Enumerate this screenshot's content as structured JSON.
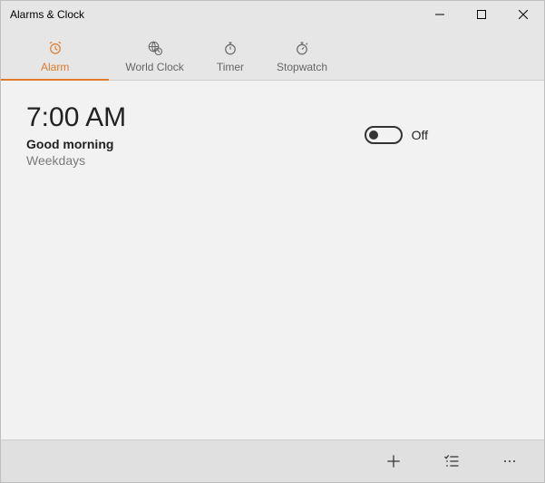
{
  "window": {
    "title": "Alarms & Clock"
  },
  "tabs": {
    "alarm": "Alarm",
    "world_clock": "World Clock",
    "timer": "Timer",
    "stopwatch": "Stopwatch"
  },
  "alarms": [
    {
      "time": "7:00 AM",
      "label": "Good morning",
      "repeat": "Weekdays",
      "state_label": "Off",
      "enabled": false
    }
  ]
}
